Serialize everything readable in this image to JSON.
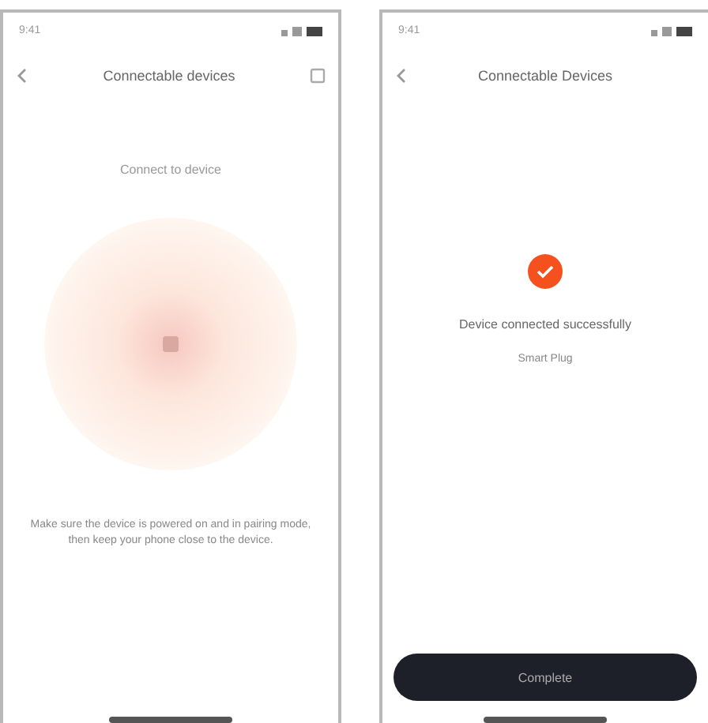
{
  "screens": [
    {
      "kind": "searching",
      "status_time": "9:41",
      "title": "Connectable devices",
      "hint": "Connect to device",
      "instructions": "Make sure the device is powered on and in pairing mode, then keep your phone close to the device."
    },
    {
      "kind": "success",
      "status_time": "9:41",
      "title": "Connectable Devices",
      "message": "Device connected successfully",
      "device_name": "Smart Plug",
      "button": "Complete"
    }
  ]
}
